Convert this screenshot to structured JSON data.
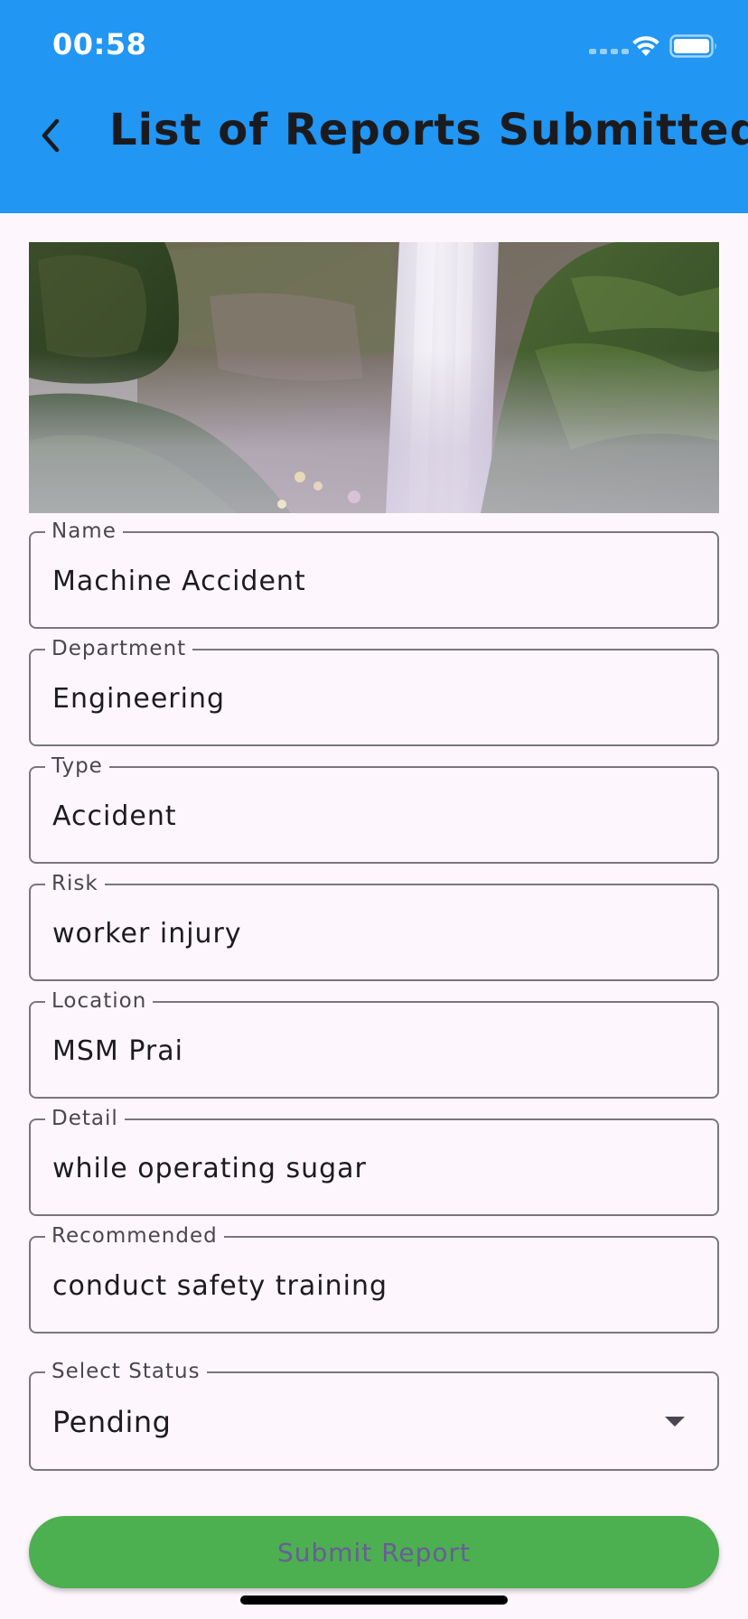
{
  "status_bar": {
    "time": "00:58"
  },
  "app_bar": {
    "title": "List of Reports Submitted",
    "back_icon": "chevron-left-icon",
    "color": "#2196f3"
  },
  "form": {
    "fields": [
      {
        "label": "Name",
        "value": "Machine Accident"
      },
      {
        "label": "Department",
        "value": "Engineering"
      },
      {
        "label": "Type",
        "value": "Accident"
      },
      {
        "label": "Risk",
        "value": "worker injury"
      },
      {
        "label": "Location",
        "value": "MSM Prai"
      },
      {
        "label": "Detail",
        "value": "while operating sugar"
      },
      {
        "label": "Recommended",
        "value": "conduct safety training"
      }
    ],
    "status_select": {
      "label": "Select Status",
      "value": "Pending",
      "icon": "arrow-drop-down-icon"
    },
    "submit_label": "Submit Report",
    "submit_color": "#4caf50"
  }
}
